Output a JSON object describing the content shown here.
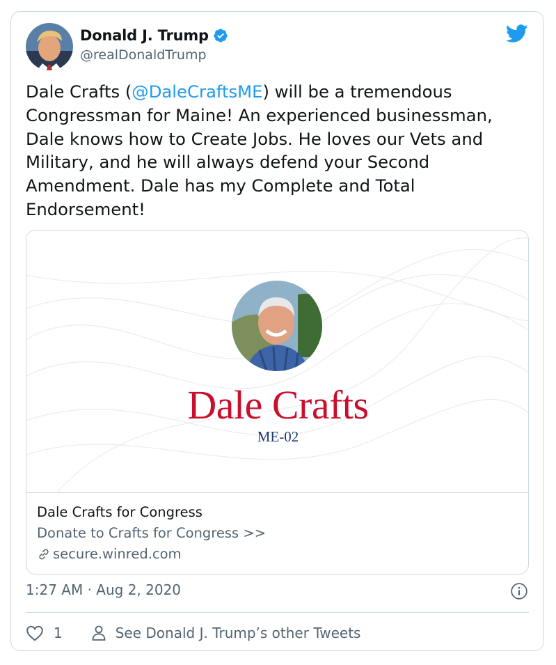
{
  "author": {
    "display_name": "Donald J. Trump",
    "handle": "@realDonaldTrump",
    "verified": true
  },
  "tweet": {
    "text_before": "Dale Crafts (",
    "mention": "@DaleCraftsME",
    "text_after": ") will be a tremendous Congressman for Maine! An experienced businessman, Dale knows how to Create Jobs. He loves our Vets and Military, and he will always defend your Second Amendment. Dale has my Complete and Total Endorsement!",
    "timestamp": "1:27 AM · Aug 2, 2020"
  },
  "card": {
    "image_title": "Dale Crafts",
    "image_subtitle": "ME-02",
    "site_title": "Dale Crafts for Congress",
    "description": "Donate to Crafts for Congress >>",
    "domain": "secure.winred.com"
  },
  "actions": {
    "like_count": "1",
    "other_tweets_label": "See Donald J. Trump’s other Tweets"
  },
  "colors": {
    "link": "#1d9bf0",
    "secondary_text": "#536471",
    "border": "#cfd9de",
    "card_title_red": "#c8102e",
    "card_subtitle_navy": "#1f3a6e"
  },
  "icons": [
    "twitter-bird-icon",
    "verified-badge-icon",
    "link-icon",
    "info-icon",
    "heart-icon",
    "profile-icon"
  ]
}
